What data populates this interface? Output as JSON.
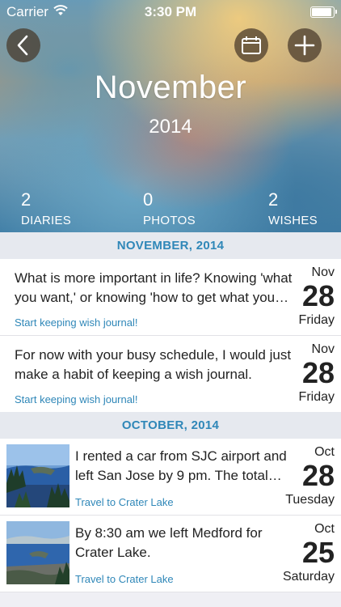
{
  "status_bar": {
    "carrier": "Carrier",
    "time": "3:30 PM"
  },
  "header": {
    "month": "November",
    "year": "2014",
    "stats": [
      {
        "count": "2",
        "label": "DIARIES"
      },
      {
        "count": "0",
        "label": "PHOTOS"
      },
      {
        "count": "2",
        "label": "WISHES"
      }
    ]
  },
  "sections": [
    {
      "title": "NOVEMBER, 2014",
      "entries": [
        {
          "text": "What is more important in life? Knowing 'what you want,' or knowing 'how to get what you want'?",
          "link": "Start keeping wish journal!",
          "month": "Nov",
          "day": "28",
          "weekday": "Friday"
        },
        {
          "text": "For now with your busy schedule, I would just make a habit of keeping a wish journal.",
          "link": "Start keeping wish journal!",
          "month": "Nov",
          "day": "28",
          "weekday": "Friday"
        }
      ]
    },
    {
      "title": "OCTOBER, 2014",
      "entries": [
        {
          "text": "I rented a car from SJC airport and left San Jose by 9 pm. The total drive was long.",
          "link": "Travel to Crater Lake",
          "month": "Oct",
          "day": "28",
          "weekday": "Tuesday"
        },
        {
          "text": "By 8:30 am we left Medford for Crater Lake.",
          "link": "Travel to Crater Lake",
          "month": "Oct",
          "day": "25",
          "weekday": "Saturday"
        }
      ]
    }
  ],
  "icons": {
    "back": "chevron-left-icon",
    "calendar": "calendar-icon",
    "add": "plus-icon",
    "wifi": "wifi-icon",
    "battery": "battery-icon"
  },
  "colors": {
    "accent": "#2f87b8",
    "section_bg": "#e6e9ef"
  }
}
